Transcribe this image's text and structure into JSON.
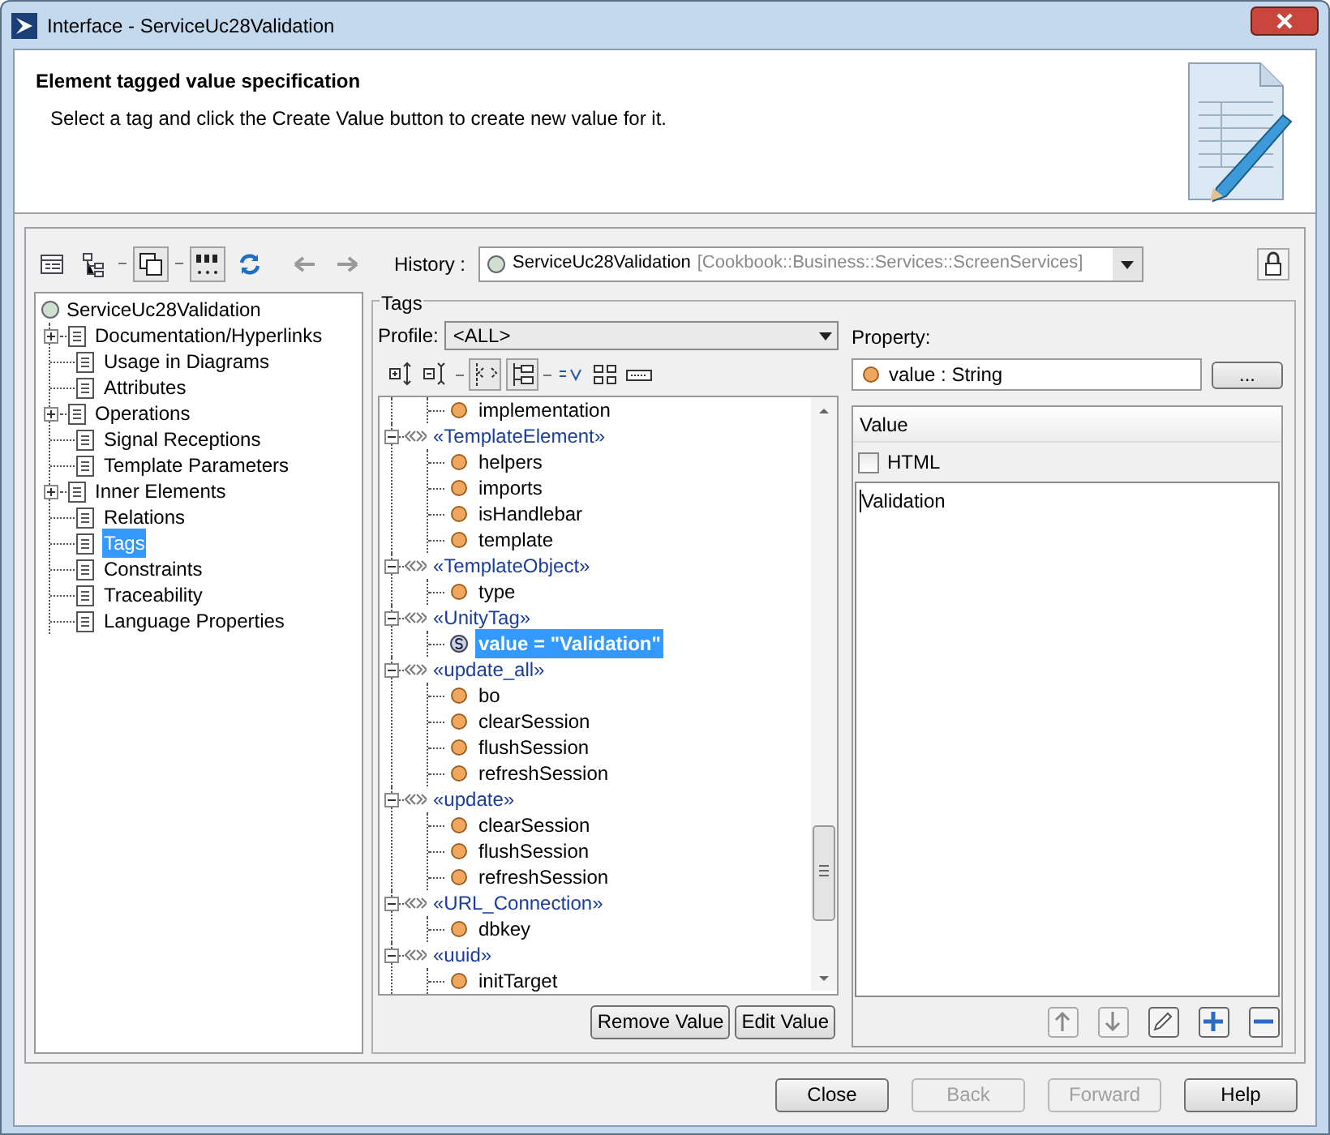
{
  "window": {
    "title": "Interface - ServiceUc28Validation"
  },
  "header": {
    "title": "Element tagged value specification",
    "description": "Select a tag and click the Create Value button to create new value for it."
  },
  "history": {
    "label": "History :",
    "element": "ServiceUc28Validation",
    "path": "[Cookbook::Business::Services::ScreenServices]"
  },
  "nav_tree": {
    "root": "ServiceUc28Validation",
    "children": [
      {
        "label": "Documentation/Hyperlinks",
        "expandable": true,
        "selected": false
      },
      {
        "label": "Usage in Diagrams",
        "expandable": false,
        "selected": false
      },
      {
        "label": "Attributes",
        "expandable": false,
        "selected": false
      },
      {
        "label": "Operations",
        "expandable": true,
        "selected": false
      },
      {
        "label": "Signal Receptions",
        "expandable": false,
        "selected": false
      },
      {
        "label": "Template Parameters",
        "expandable": false,
        "selected": false
      },
      {
        "label": "Inner Elements",
        "expandable": true,
        "selected": false
      },
      {
        "label": "Relations",
        "expandable": false,
        "selected": false
      },
      {
        "label": "Tags",
        "expandable": false,
        "selected": true
      },
      {
        "label": "Constraints",
        "expandable": false,
        "selected": false
      },
      {
        "label": "Traceability",
        "expandable": false,
        "selected": false
      },
      {
        "label": "Language Properties",
        "expandable": false,
        "selected": false
      }
    ]
  },
  "tags": {
    "title": "Tags",
    "profile_label": "Profile:",
    "profile": "<ALL>",
    "tree": [
      {
        "kind": "continued",
        "children": [
          {
            "kind": "property",
            "label": "implementation",
            "selected": false
          }
        ]
      },
      {
        "kind": "stereotype",
        "label": "«TemplateElement»",
        "children": [
          {
            "kind": "property",
            "label": "helpers",
            "selected": false
          },
          {
            "kind": "property",
            "label": "imports",
            "selected": false
          },
          {
            "kind": "property",
            "label": "isHandlebar",
            "selected": false
          },
          {
            "kind": "property",
            "label": "template",
            "selected": false
          }
        ]
      },
      {
        "kind": "stereotype",
        "label": "«TemplateObject»",
        "children": [
          {
            "kind": "property",
            "label": "type",
            "selected": false
          }
        ]
      },
      {
        "kind": "stereotype",
        "label": "«UnityTag»",
        "children": [
          {
            "kind": "value",
            "label": "value = \"Validation\"",
            "selected": true
          }
        ]
      },
      {
        "kind": "stereotype",
        "label": "«update_all»",
        "children": [
          {
            "kind": "property",
            "label": "bo",
            "selected": false
          },
          {
            "kind": "property",
            "label": "clearSession",
            "selected": false
          },
          {
            "kind": "property",
            "label": "flushSession",
            "selected": false
          },
          {
            "kind": "property",
            "label": "refreshSession",
            "selected": false
          }
        ]
      },
      {
        "kind": "stereotype",
        "label": "«update»",
        "children": [
          {
            "kind": "property",
            "label": "clearSession",
            "selected": false
          },
          {
            "kind": "property",
            "label": "flushSession",
            "selected": false
          },
          {
            "kind": "property",
            "label": "refreshSession",
            "selected": false
          }
        ]
      },
      {
        "kind": "stereotype",
        "label": "«URL_Connection»",
        "children": [
          {
            "kind": "property",
            "label": "dbkey",
            "selected": false
          }
        ]
      },
      {
        "kind": "stereotype",
        "label": "«uuid»",
        "children": [
          {
            "kind": "property",
            "label": "initTarget",
            "selected": false
          }
        ]
      }
    ],
    "buttons": [
      "Remove Value",
      "Edit Value"
    ]
  },
  "property": {
    "label": "Property:",
    "value": "value : String",
    "browse": "...",
    "column": "Value",
    "html_label": "HTML",
    "html_checked": false,
    "text": "Validation"
  },
  "footer_buttons": [
    {
      "label": "Close",
      "disabled": false
    },
    {
      "label": "Back",
      "disabled": true
    },
    {
      "label": "Forward",
      "disabled": true
    },
    {
      "label": "Help",
      "disabled": false
    }
  ]
}
